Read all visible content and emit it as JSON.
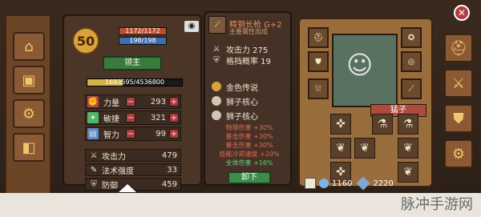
{
  "player": {
    "level": "50",
    "hp": "1172/1172",
    "mp": "198/198",
    "title_button": "领主",
    "exp": "1693595/4536800",
    "exp_ratio": 0.373
  },
  "stats": [
    {
      "name": "力量",
      "value": "293",
      "icon": "fist-icon"
    },
    {
      "name": "敏捷",
      "value": "321",
      "icon": "feather-icon"
    },
    {
      "name": "智力",
      "value": "99",
      "icon": "book-icon"
    }
  ],
  "attributes": [
    {
      "label": "攻击力",
      "value": "479",
      "icon": "sword-icon"
    },
    {
      "label": "法术强度",
      "value": "33",
      "icon": "wand-icon"
    },
    {
      "label": "防御",
      "value": "459",
      "icon": "shield-icon"
    }
  ],
  "item": {
    "name": "精钢长枪 G+2",
    "subtitle": "主要属性加成",
    "stats": [
      {
        "label": "攻击力 275",
        "icon": "sword-icon"
      },
      {
        "label": "格挡概率 19",
        "icon": "shield-icon"
      }
    ],
    "talents": [
      {
        "label": "金色传说",
        "icon": "lantern-icon"
      },
      {
        "label": "狮子核心",
        "icon": "lion-icon"
      },
      {
        "label": "狮子核心",
        "icon": "lion-icon"
      }
    ],
    "bonuses": [
      {
        "text": "物理伤害 +30%",
        "color": "red"
      },
      {
        "text": "暴击伤害 +30%",
        "color": "red"
      },
      {
        "text": "暴击伤害 +30%",
        "color": "red"
      },
      {
        "text": "技能冷却速度 +20%",
        "color": "red"
      },
      {
        "text": "全体伤害 +16%",
        "color": "green"
      }
    ],
    "equip_button": "卸下"
  },
  "hero": {
    "name": "猛子"
  },
  "bottom": {
    "left_value": "1160",
    "right_value": "2220"
  },
  "watermark": "脉冲手游网"
}
